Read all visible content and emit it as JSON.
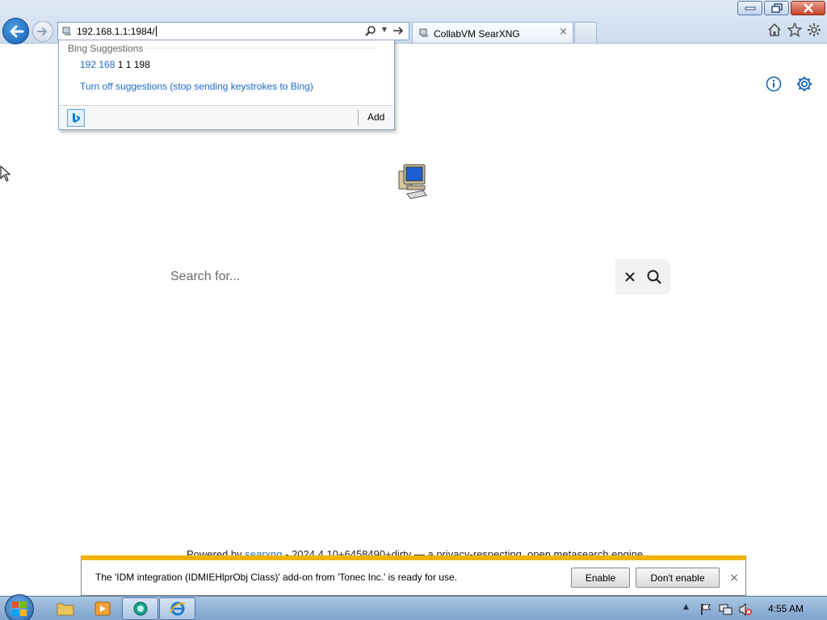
{
  "window": {
    "minimize_icon": "minimize-icon",
    "maximize_icon": "restore-icon",
    "close_icon": "close-icon"
  },
  "address_bar": {
    "value": "192.168.1.1:1984/"
  },
  "tab": {
    "title": "CollabVM SearXNG",
    "close_glyph": "×"
  },
  "autocomplete": {
    "header": "Bing Suggestions",
    "suggestion_highlight": "192 168",
    "suggestion_rest": " 1 1 198",
    "turn_off": "Turn off suggestions (stop sending keystrokes to Bing)",
    "add_label": "Add"
  },
  "page": {
    "search_placeholder": "Search for...",
    "footer_before": "Powered by ",
    "footer_link": "searxng",
    "footer_after": " - 2024.4.10+6458490+dirty — a privacy-respecting, open metasearch engine"
  },
  "notification": {
    "message": "The 'IDM integration (IDMIEHlprObj Class)' add-on from 'Tonec Inc.' is ready for use.",
    "enable_label": "Enable",
    "dont_enable_label": "Don't enable",
    "close_glyph": "×"
  },
  "taskbar": {
    "clock": "4:55 AM",
    "show_hidden": "▲"
  },
  "colors": {
    "accent": "#1b6ac9",
    "notification_stripe": "#f0b300",
    "settings_icon": "#1a67b5"
  }
}
